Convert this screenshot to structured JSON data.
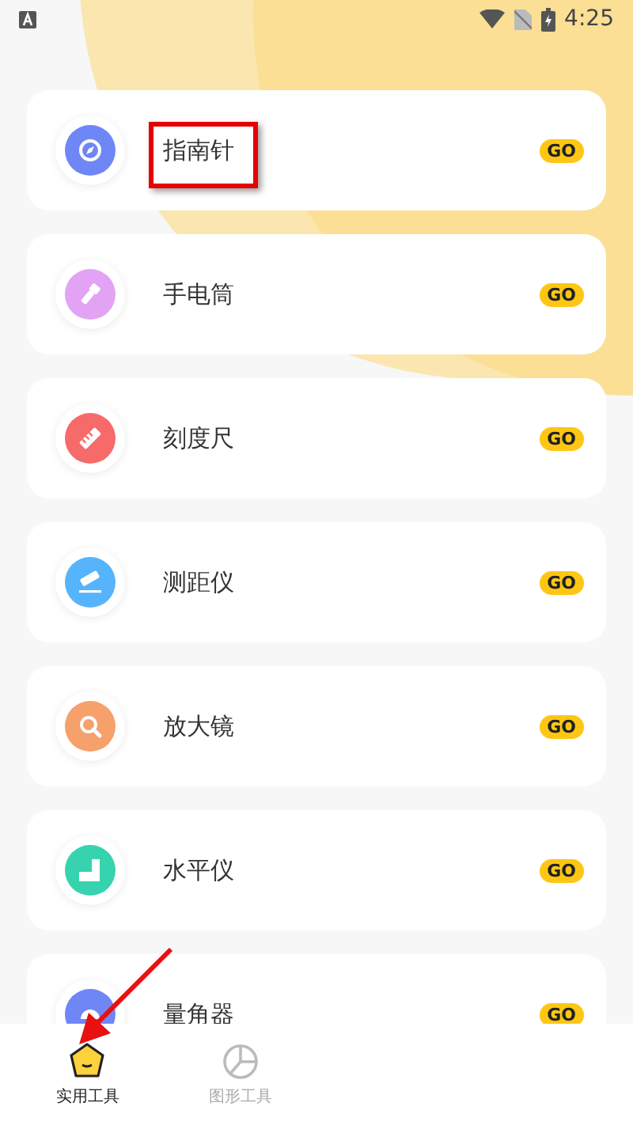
{
  "status_bar": {
    "time": "4:25"
  },
  "tools": [
    {
      "name": "指南针",
      "button": "GO",
      "kind": "compass",
      "color": "#6f86f7",
      "highlighted": true
    },
    {
      "name": "手电筒",
      "button": "GO",
      "kind": "flashlight",
      "color": "#e3a3f5",
      "highlighted": false
    },
    {
      "name": "刻度尺",
      "button": "GO",
      "kind": "ruler",
      "color": "#f76a6a",
      "highlighted": false
    },
    {
      "name": "测距仪",
      "button": "GO",
      "kind": "rangefinder",
      "color": "#55b4fb",
      "highlighted": false
    },
    {
      "name": "放大镜",
      "button": "GO",
      "kind": "magnifier",
      "color": "#f6a06b",
      "highlighted": false
    },
    {
      "name": "水平仪",
      "button": "GO",
      "kind": "level",
      "color": "#36d3ae",
      "highlighted": false
    },
    {
      "name": "量角器",
      "button": "GO",
      "kind": "protractor",
      "color": "#6f86f7",
      "highlighted": false
    }
  ],
  "tabs": [
    {
      "label": "实用工具",
      "kind": "tools",
      "selected": true,
      "pointed": true
    },
    {
      "label": "图形工具",
      "kind": "shapes",
      "selected": false,
      "pointed": false
    }
  ]
}
